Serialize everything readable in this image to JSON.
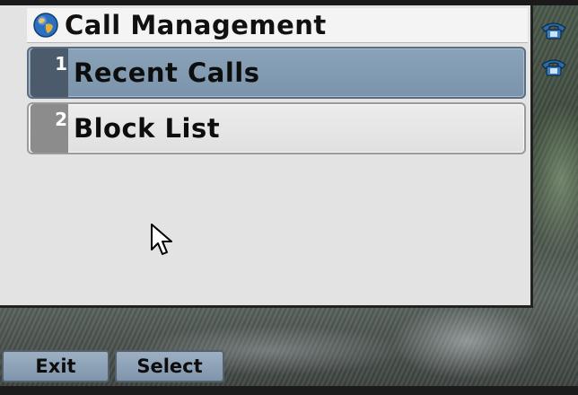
{
  "window": {
    "title": "Call Management",
    "title_icon": "globe-icon"
  },
  "menu": {
    "items": [
      {
        "number": "1",
        "label": "Recent Calls",
        "selected": true
      },
      {
        "number": "2",
        "label": "Block List",
        "selected": false
      }
    ]
  },
  "line_icons": [
    "phone-icon",
    "phone-icon"
  ],
  "softkeys": {
    "exit_label": "Exit",
    "select_label": "Select"
  },
  "colors": {
    "selected_item": "#7b94ab",
    "unselected_item": "#e0e0e0",
    "softkey": "#8ea3b8"
  }
}
